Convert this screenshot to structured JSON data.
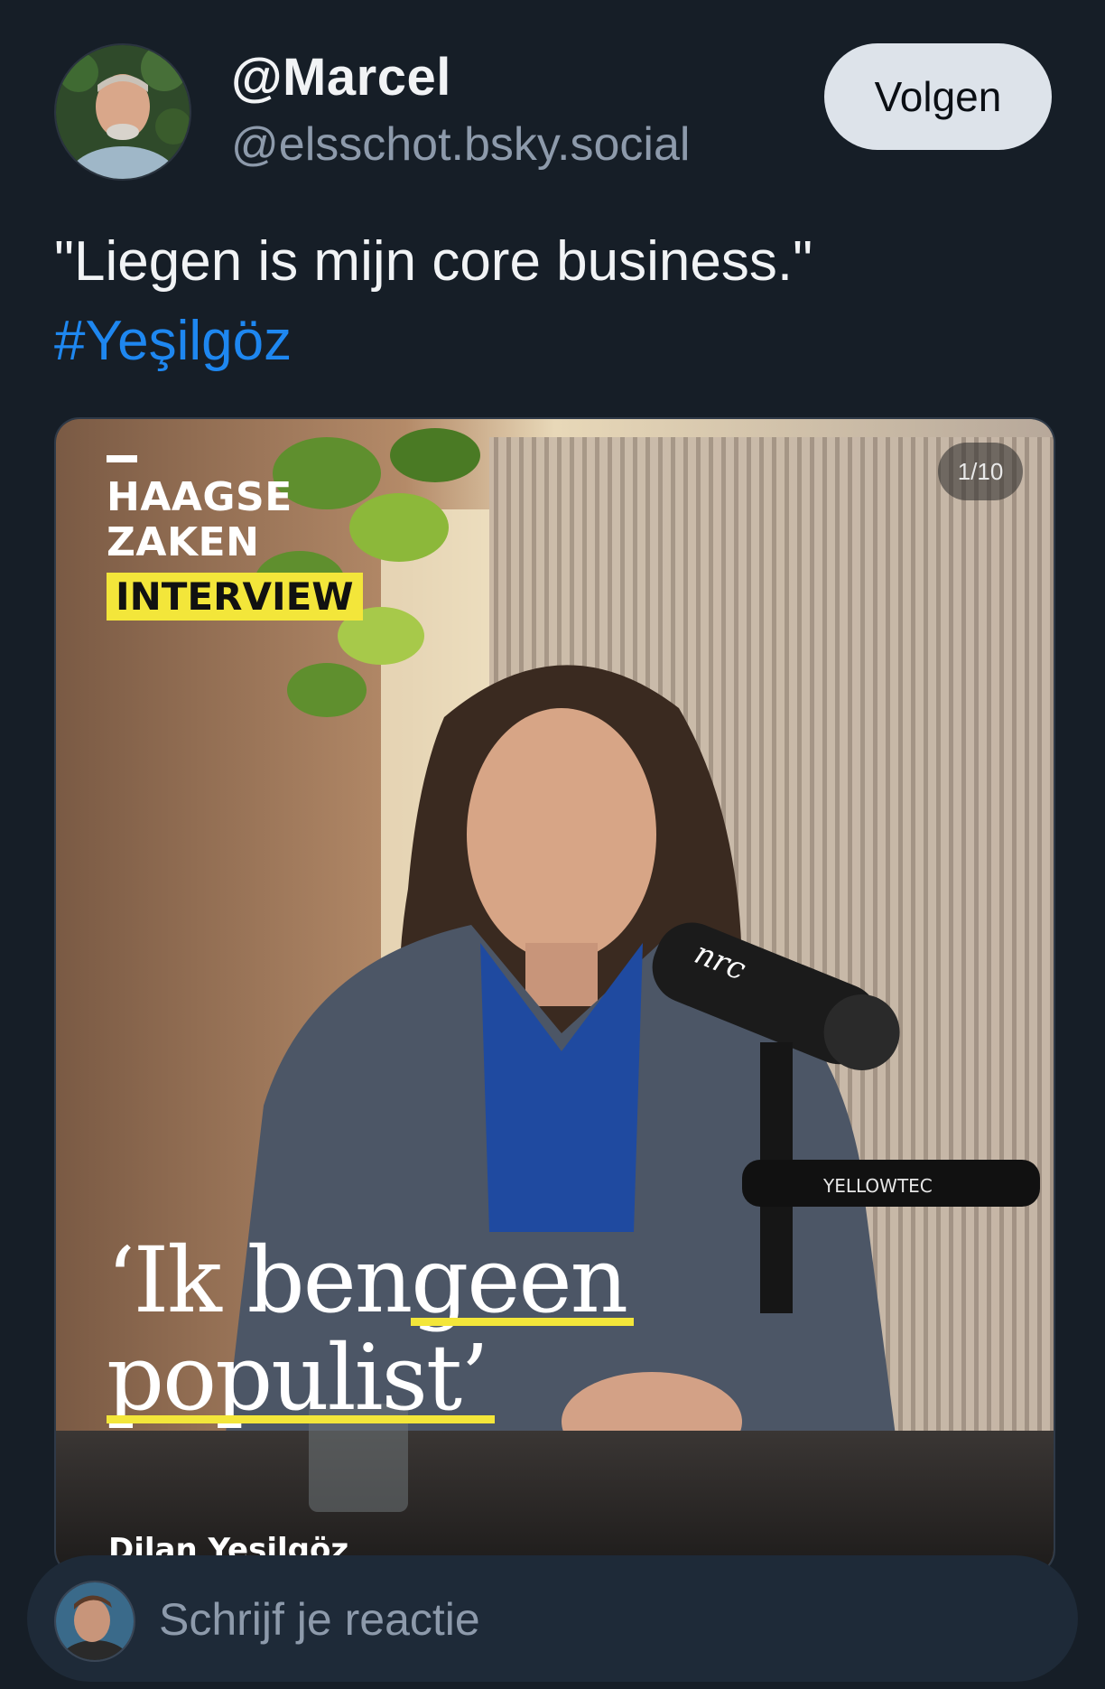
{
  "author": {
    "display_name": "@Marcel",
    "handle": "@elsschot.bsky.social",
    "avatar_icon": "profile-photo"
  },
  "follow_button": {
    "label": "Volgen"
  },
  "post": {
    "text": "\"Liegen is mijn core business.\"",
    "hashtag": "#Yeşilgöz"
  },
  "media": {
    "counter": "1/10",
    "brand_line1": "HAAGSE",
    "brand_line2": "ZAKEN",
    "brand_badge": "INTERVIEW",
    "headline_part1": "‘Ik ben ",
    "headline_part2": "geen",
    "headline_part3": "populist’",
    "caption_name": "Dilan Yesilgöz",
    "mic_brand": "nrc",
    "stand_brand": "YELLOWTEC"
  },
  "reply": {
    "placeholder": "Schrijf je reactie",
    "avatar_icon": "user-avatar"
  },
  "colors": {
    "background": "#161e27",
    "accent_link": "#1e87f0",
    "button_bg": "#dde3ea",
    "highlight_yellow": "#f3e63a"
  }
}
